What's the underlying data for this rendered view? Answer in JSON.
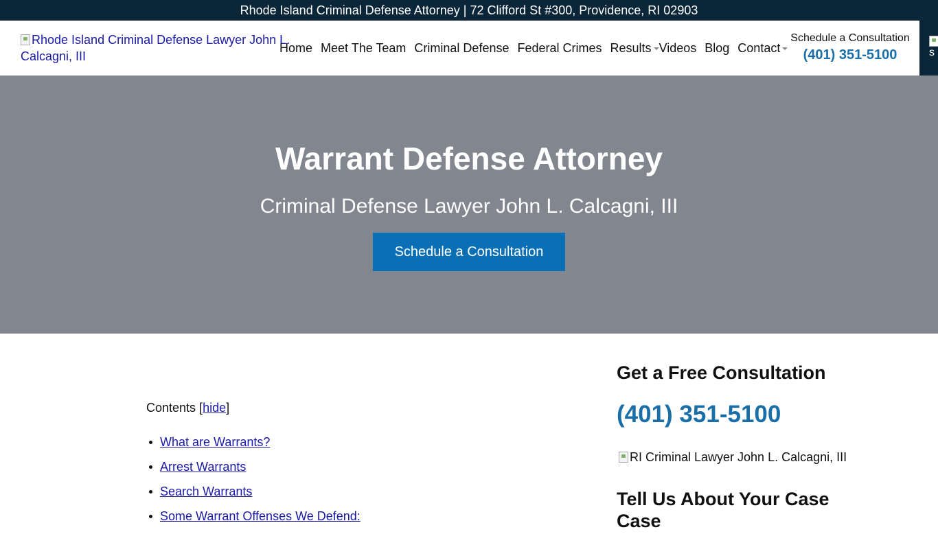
{
  "topbar": {
    "text": "Rhode Island Criminal Defense Attorney | 72 Clifford St #300, Providence, RI 02903"
  },
  "header": {
    "logo_alt": "Rhode Island Criminal Defense Lawyer John L. Calcagni, III",
    "nav": [
      {
        "label": "Home"
      },
      {
        "label": "Meet The Team"
      },
      {
        "label": "Criminal Defense"
      },
      {
        "label": "Federal Crimes"
      },
      {
        "label": "Results",
        "has_dropdown": true
      },
      {
        "label": "Videos"
      },
      {
        "label": "Blog"
      },
      {
        "label": "Contact",
        "has_dropdown": true
      }
    ],
    "cta_label": "Schedule a Consultation",
    "cta_phone": "(401) 351-5100",
    "edge_text": "s"
  },
  "hero": {
    "title": "Warrant Defense Attorney",
    "subtitle": "Criminal Defense Lawyer John L. Calcagni, III",
    "button": "Schedule a Consultation"
  },
  "toc": {
    "label": "Contents",
    "toggle": "hide",
    "items": [
      "What are Warrants?",
      "Arrest Warrants",
      "Search Warrants",
      "Some Warrant Offenses We Defend:"
    ]
  },
  "sidebar": {
    "heading": "Get a Free Consultation",
    "phone": "(401) 351-5100",
    "image_alt": "RI Criminal Lawyer John L. Calcagni, III",
    "heading2": "Tell Us About Your Case",
    "heading2_overflow": "Case"
  },
  "colors": {
    "topbar_bg": "#0a2638",
    "hero_bg": "#82878f",
    "accent_blue": "#1a6fa8",
    "button_blue": "#0b6fb5",
    "link": "#1a1aa6"
  }
}
